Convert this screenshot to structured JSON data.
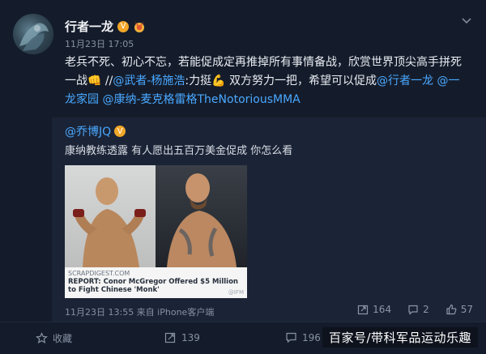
{
  "post": {
    "author": "行者一龙",
    "meta": "11月23日 17:05",
    "content_parts": [
      {
        "text": "老兵不死、初心不忘，若能促成定再推掉所有事情备战，欣赏世界顶尖高手拼死一战",
        "link": false
      },
      {
        "text": "👊 //",
        "link": false
      },
      {
        "text": "@武者-杨施浩",
        "link": true
      },
      {
        "text": ":力挺💪 双方努力一把，希望可以促成",
        "link": false
      },
      {
        "text": "@行者一龙",
        "link": true
      },
      {
        "text": " ",
        "link": false
      },
      {
        "text": "@一龙家园",
        "link": true
      },
      {
        "text": " ",
        "link": false
      },
      {
        "text": "@康纳-麦克格雷格TheNotoriousMMA",
        "link": true
      }
    ]
  },
  "repost": {
    "author": "@乔博JQ",
    "text": "康纳教练透露 有人愿出五百万美金促成 你怎么看",
    "thumbnail": {
      "source": "SCRAPDIGEST.COM",
      "title": "REPORT: Conor McGregor Offered $5 Million to Fight Chinese 'Monk'",
      "watermark": "@IFM"
    },
    "meta": "11月23日 13:55 来自 iPhone客户端",
    "reposts": "164",
    "comments": "2",
    "likes": "57"
  },
  "footer": {
    "collect_label": "收藏",
    "reposts": "139",
    "comments": "196"
  },
  "watermark": "百家号/带科军品运动乐趣",
  "colors": {
    "background": "#141c2b",
    "card": "#1b2436",
    "link": "#4aa8ff",
    "muted": "#8792a3"
  }
}
